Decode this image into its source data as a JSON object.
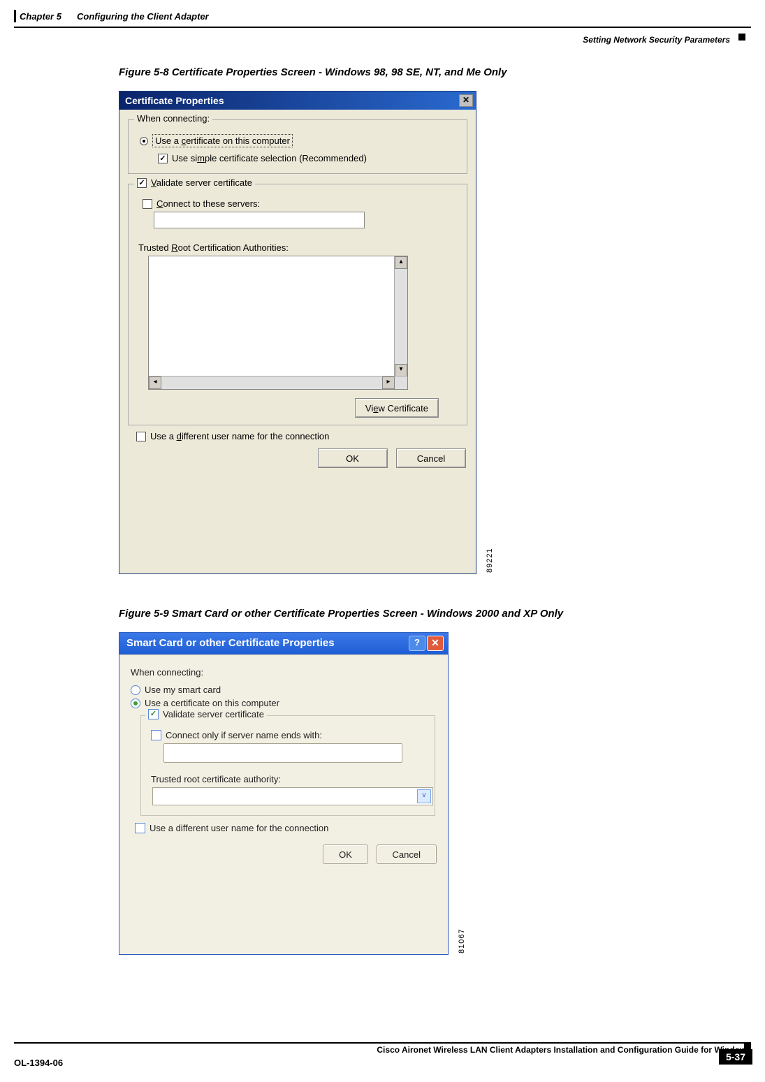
{
  "header": {
    "chapter_left": "Chapter 5",
    "chapter_title": "Configuring the Client Adapter",
    "section_right": "Setting Network Security Parameters"
  },
  "captions": {
    "fig58": "Figure 5-8    Certificate Properties Screen - Windows 98, 98 SE, NT, and Me Only",
    "fig59": "Figure 5-9    Smart Card or other Certificate Properties Screen - Windows 2000 and XP Only"
  },
  "dialog1": {
    "title": "Certificate Properties",
    "when_connecting": "When connecting:",
    "use_cert_prefix": "Use a ",
    "use_cert_c": "c",
    "use_cert_suffix": "ertificate on this computer",
    "simple_prefix": "Use si",
    "simple_m": "m",
    "simple_suffix": "ple certificate selection (Recommended)",
    "validate_v": "V",
    "validate_suffix": "alidate server certificate",
    "connect_c": "C",
    "connect_suffix": "onnect to these servers:",
    "trusted_prefix": "Trusted ",
    "trusted_r": "R",
    "trusted_suffix": "oot Certification Authorities:",
    "view_prefix": "Vi",
    "view_e": "e",
    "view_suffix": "w Certificate",
    "diff_prefix": "Use a ",
    "diff_d": "d",
    "diff_suffix": "ifferent user name for the connection",
    "ok": "OK",
    "cancel": "Cancel",
    "sidecode": "89221"
  },
  "dialog2": {
    "title": "Smart Card or other Certificate Properties",
    "when_connecting": "When connecting:",
    "use_smart": "Use my smart card",
    "use_cert": "Use a certificate on this computer",
    "validate": "Validate server certificate",
    "connect_only": "Connect only if server name ends with:",
    "trusted": "Trusted root certificate authority:",
    "diff": "Use a different user name for the connection",
    "ok": "OK",
    "cancel": "Cancel",
    "sidecode": "81067"
  },
  "footer": {
    "guide": "Cisco Aironet Wireless LAN Client Adapters Installation and Configuration Guide for Windows",
    "doc": "OL-1394-06",
    "page": "5-37"
  }
}
